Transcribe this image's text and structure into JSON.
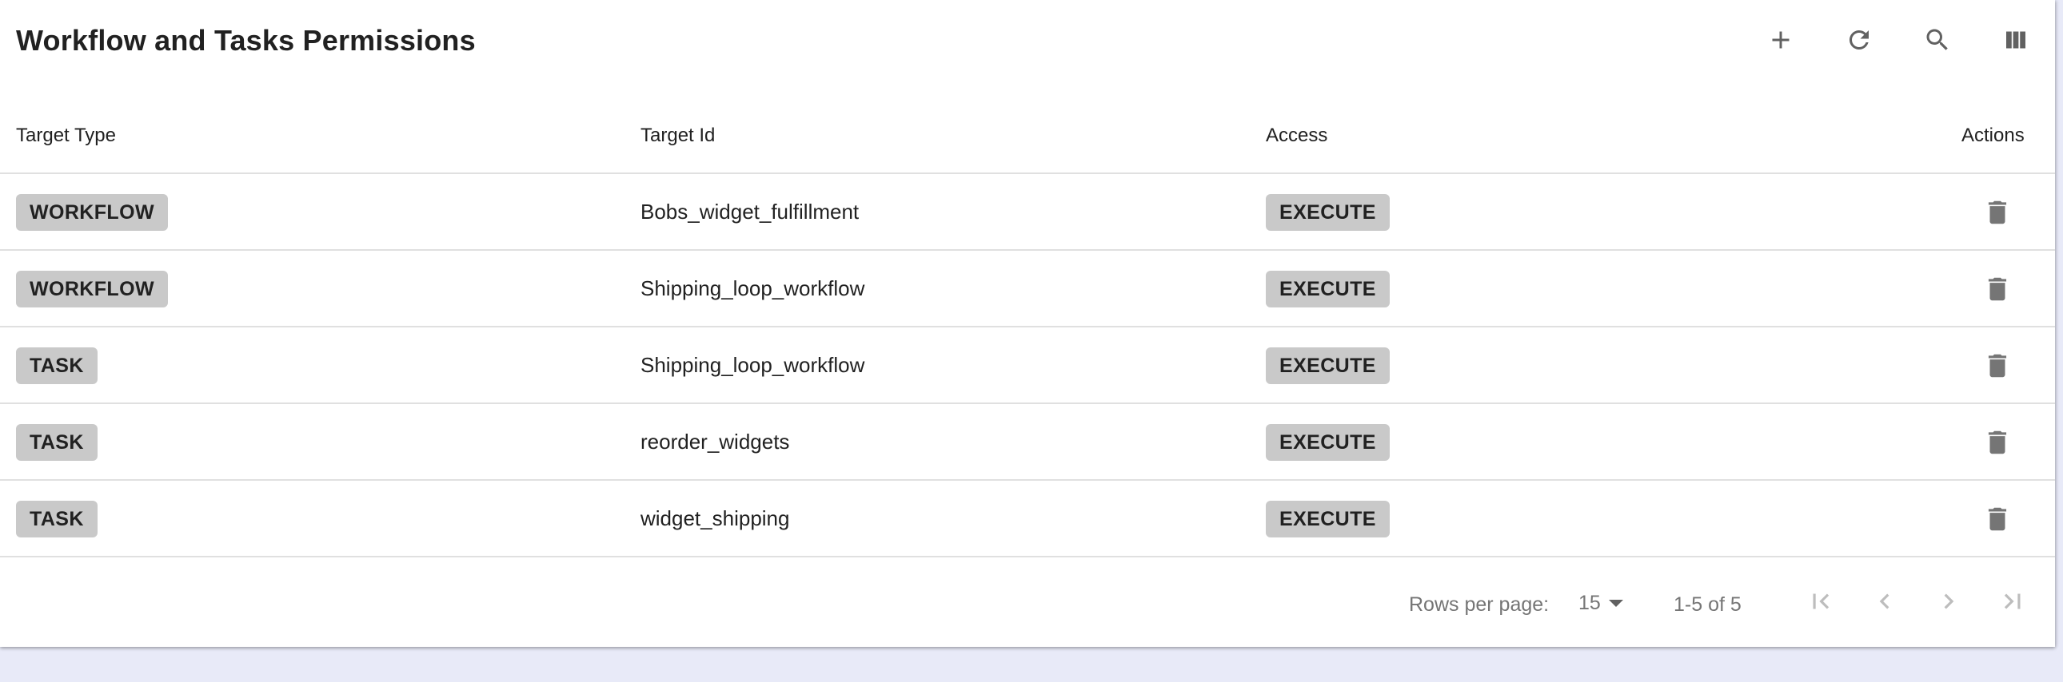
{
  "title": "Workflow and Tasks Permissions",
  "toolbar": {
    "icons": [
      "add-icon",
      "refresh-icon",
      "search-icon",
      "view-columns-icon"
    ]
  },
  "columns": {
    "target_type": "Target Type",
    "target_id": "Target Id",
    "access": "Access",
    "actions": "Actions"
  },
  "rows": [
    {
      "type": "WORKFLOW",
      "id": "Bobs_widget_fulfillment",
      "access": "EXECUTE"
    },
    {
      "type": "WORKFLOW",
      "id": "Shipping_loop_workflow",
      "access": "EXECUTE"
    },
    {
      "type": "TASK",
      "id": "Shipping_loop_workflow",
      "access": "EXECUTE"
    },
    {
      "type": "TASK",
      "id": "reorder_widgets",
      "access": "EXECUTE"
    },
    {
      "type": "TASK",
      "id": "widget_shipping",
      "access": "EXECUTE"
    }
  ],
  "footer": {
    "rows_per_page_label": "Rows per page:",
    "rows_per_page_value": "15",
    "range_text": "1-5 of 5"
  },
  "colors": {
    "chip_background": "#c9c9c9",
    "icon": "#616161",
    "disabled_icon": "#bdbdbd",
    "page_background": "#e8eaf8"
  }
}
